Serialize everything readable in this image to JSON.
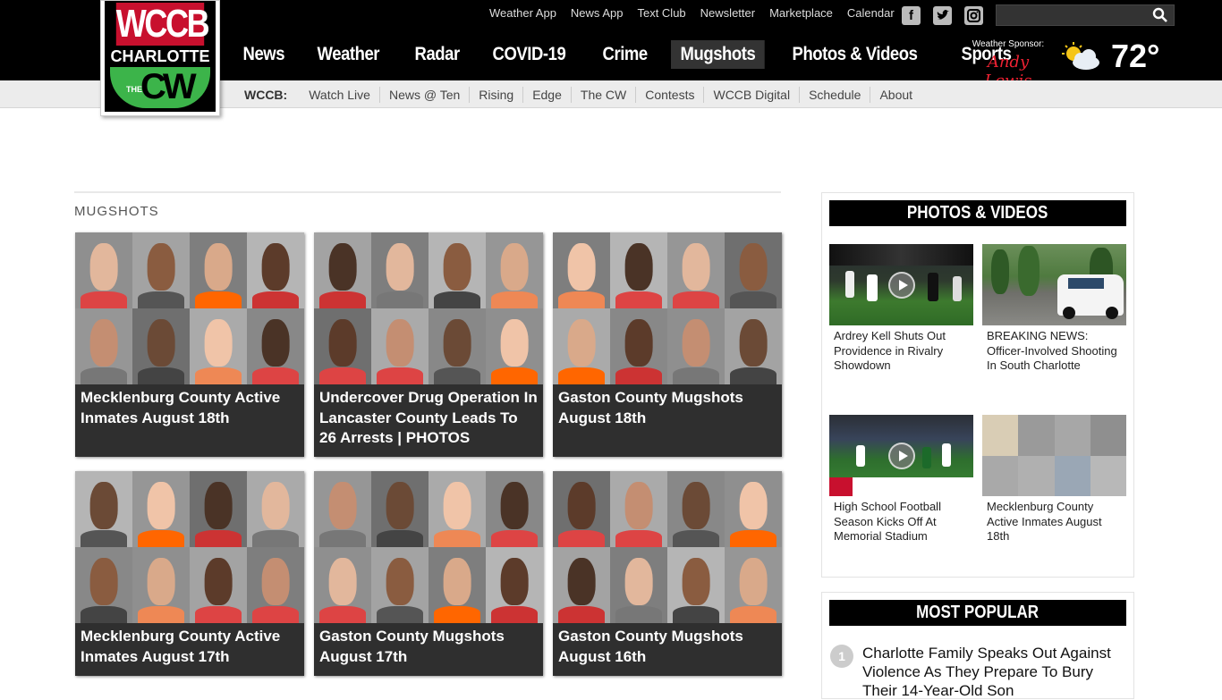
{
  "logo": {
    "top_text": "WCCB",
    "city": "CHARLOTTE",
    "network_prefix": "THE",
    "network": "CW"
  },
  "utility_links": [
    "Weather App",
    "News App",
    "Text Club",
    "Newsletter",
    "Marketplace",
    "Calendar"
  ],
  "social": {
    "facebook": "facebook-icon",
    "twitter": "twitter-icon",
    "instagram": "instagram-icon"
  },
  "search": {
    "placeholder": "",
    "value": ""
  },
  "main_nav": [
    {
      "label": "News"
    },
    {
      "label": "Weather"
    },
    {
      "label": "Radar"
    },
    {
      "label": "COVID-19"
    },
    {
      "label": "Crime"
    },
    {
      "label": "Mugshots",
      "active": true
    },
    {
      "label": "Photos & Videos"
    },
    {
      "label": "Sports"
    }
  ],
  "weather": {
    "sponsor_label": "Weather Sponsor:",
    "sponsor_name": "Andy Lewis",
    "temperature": "72°",
    "condition_icon": "partly-cloudy-icon"
  },
  "sub_nav": {
    "brand": "WCCB:",
    "links": [
      "Watch Live",
      "News @ Ten",
      "Rising",
      "Edge",
      "The CW",
      "Contests",
      "WCCB Digital",
      "Schedule",
      "About"
    ]
  },
  "section": {
    "title": "MUGSHOTS"
  },
  "cards": [
    {
      "title": "Mecklenburg County Active Inmates August 18th"
    },
    {
      "title": "Undercover Drug Operation In Lancaster County Leads To 26 Arrests | PHOTOS"
    },
    {
      "title": "Gaston County Mugshots August 18th"
    },
    {
      "title": "Mecklenburg County Active Inmates August 17th"
    },
    {
      "title": "Gaston County Mugshots August 17th"
    },
    {
      "title": "Gaston County Mugshots August 16th"
    }
  ],
  "sidebar": {
    "photos_videos": {
      "heading": "PHOTOS & VIDEOS",
      "items": [
        {
          "caption": "Ardrey Kell Shuts Out Providence in Rivalry Showdown"
        },
        {
          "caption": "BREAKING NEWS: Officer-Involved Shooting In South Charlotte"
        },
        {
          "caption": "High School Football Season Kicks Off At Memorial Stadium"
        },
        {
          "caption": "Mecklenburg County Active Inmates August 18th"
        }
      ]
    },
    "most_popular": {
      "heading": "MOST POPULAR",
      "items": [
        {
          "rank": "1",
          "title": "Charlotte Family Speaks Out Against Violence As They Prepare To Bury Their 14-Year-Old Son"
        }
      ]
    }
  },
  "colors": {
    "brand_red": "#c8102e",
    "cw_green": "#3cb44a",
    "nav_active": "#333333"
  }
}
